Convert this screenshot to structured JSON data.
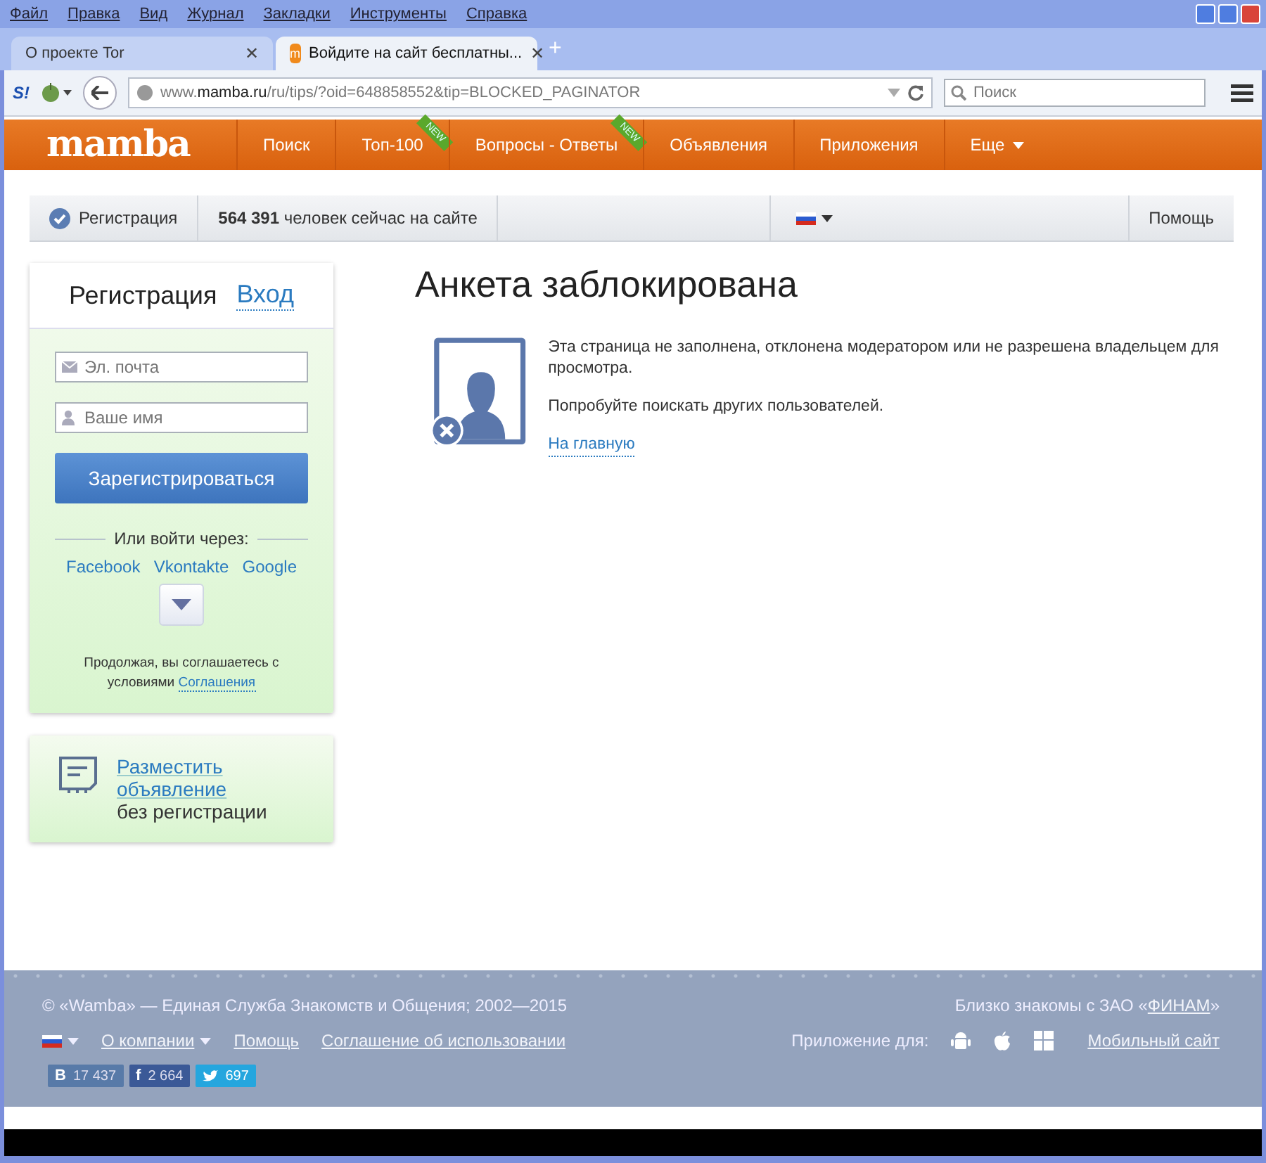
{
  "browser": {
    "menu": [
      "Файл",
      "Правка",
      "Вид",
      "Журнал",
      "Закладки",
      "Инструменты",
      "Справка"
    ],
    "tabs": [
      {
        "label": "О проекте Tor",
        "selected": false,
        "close": "✕"
      },
      {
        "label": "Войдите на сайт бесплатны...",
        "selected": true,
        "favicon": "m",
        "close": "✕"
      }
    ],
    "new_tab": "+",
    "addon": "S!",
    "url": "www.**mamba.ru**/ru/tips/?oid=648858552&tip=BLOCKED_PAGINATOR",
    "search": {
      "placeholder": "Поиск"
    }
  },
  "site": {
    "logo": "mamba",
    "nav": [
      {
        "label": "Поиск"
      },
      {
        "label": "Топ-100",
        "badge": "NEW"
      },
      {
        "label": "Вопросы - Ответы",
        "badge": "NEW"
      },
      {
        "label": "Объявления"
      },
      {
        "label": "Приложения"
      },
      {
        "label": "Еще",
        "dropdown": true
      }
    ],
    "info_bar": {
      "registration": "Регистрация",
      "online": "**564 391** человек сейчас на сайте",
      "help": "Помощь"
    },
    "auth": {
      "tabs": [
        {
          "label": "Регистрация",
          "selected": true
        },
        {
          "label": "Вход",
          "selected": false
        }
      ],
      "fields": [
        {
          "kind": "email",
          "placeholder": "Эл. почта"
        },
        {
          "kind": "name",
          "placeholder": "Ваше имя"
        }
      ],
      "submit": "Зарегистрироваться",
      "social_label": "Или войти через:",
      "providers": [
        "Facebook",
        "Vkontakte",
        "Google"
      ],
      "terms": "Продолжая, вы соглашаетесь с условиями",
      "terms_link": "Соглашения"
    },
    "ad": {
      "link": "Разместить объявление",
      "text": "без регистрации"
    },
    "main": {
      "title": "Анкета заблокирована",
      "paragraphs": [
        "Эта страница не заполнена, отклонена модератором или не разрешена владельцем для просмотра.",
        "Попробуйте поискать других пользователей."
      ],
      "link": "На главную"
    },
    "footer": {
      "copyright": "© «Wamba» — Единая Служба Знакомств и Общения; 2002—2015",
      "partner_before": "Близко знакомы с ЗАО «",
      "partner_link": "ФИНАМ",
      "partner_after": "»",
      "links": [
        {
          "label": "О компании",
          "dropdown": true
        },
        {
          "label": "Помощь",
          "dropdown": false
        },
        {
          "label": "Соглашение об использовании",
          "dropdown": false
        }
      ],
      "social": [
        {
          "kind": "vk",
          "icon": "В",
          "count": "17 437"
        },
        {
          "kind": "facebook",
          "icon": "f",
          "count": "2 664"
        },
        {
          "kind": "twitter",
          "count": "697"
        }
      ],
      "apps_label": "Приложение для:",
      "mobile": "Мобильный сайт"
    }
  }
}
